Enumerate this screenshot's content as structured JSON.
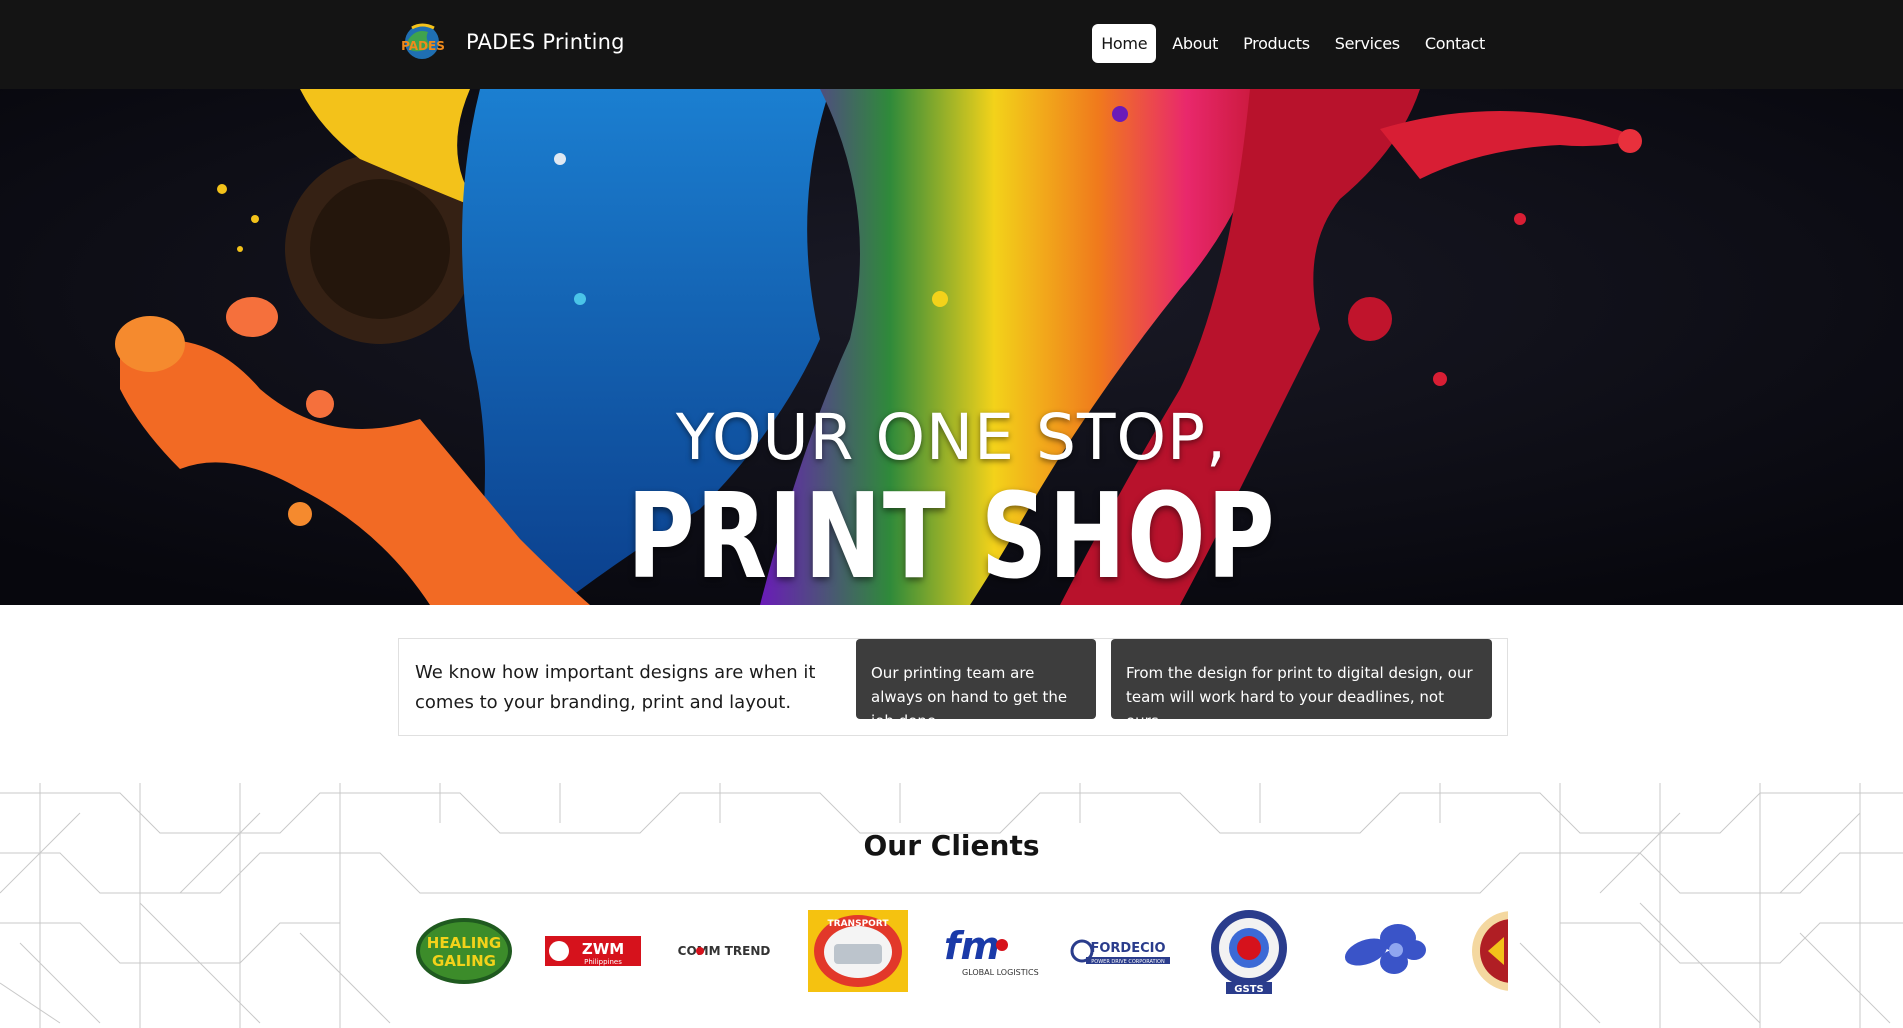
{
  "brand": {
    "name": "PADES Printing",
    "logo_text": "PADES"
  },
  "nav": {
    "items": [
      {
        "label": "Home",
        "active": true
      },
      {
        "label": "About",
        "active": false
      },
      {
        "label": "Products",
        "active": false
      },
      {
        "label": "Services",
        "active": false
      },
      {
        "label": "Contact",
        "active": false
      }
    ]
  },
  "hero": {
    "line1": "YOUR ONE STOP,",
    "line2": "PRINT SHOP"
  },
  "info": {
    "lead": "We know how important designs are when it comes to your branding, print and layout.",
    "card1": "Our printing team are always on hand to get the job done.",
    "card2": "From the design for print to digital design, our team will work hard to your deadlines, not ours."
  },
  "clients": {
    "title": "Our Clients",
    "logos": [
      {
        "name": "healing-galing",
        "text1": "HEALING",
        "text2": "GALING"
      },
      {
        "name": "zwm",
        "text1": "ZWM",
        "text2": "Philippines"
      },
      {
        "name": "comm-trend",
        "text1": "COMM TREND"
      },
      {
        "name": "tradeboard-van",
        "text1": "TRANSPORT"
      },
      {
        "name": "fm-global",
        "text1": "fm",
        "text2": "GLOBAL LOGISTICS"
      },
      {
        "name": "fordecio",
        "text1": "FORDECIO",
        "text2": "POWER DRIVE CORPORATION"
      },
      {
        "name": "gsts",
        "text1": "GSTS"
      },
      {
        "name": "flower-logo"
      },
      {
        "name": "seal-partial"
      }
    ]
  },
  "colors": {
    "nav_bg": "#141414",
    "card_bg": "#3d3d3d",
    "hero_bg": "#0c0c14"
  }
}
